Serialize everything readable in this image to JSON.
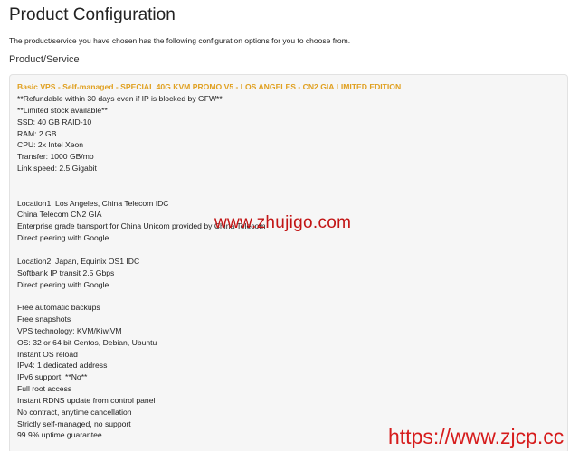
{
  "page": {
    "title": "Product Configuration",
    "intro": "The product/service you have chosen has the following configuration options for you to choose from.",
    "section_title": "Product/Service"
  },
  "product": {
    "name": "Basic VPS - Self-managed - SPECIAL 40G KVM PROMO V5 - LOS ANGELES - CN2 GIA LIMITED EDITION",
    "lines": [
      "**Refundable within 30 days even if IP is blocked by GFW**",
      "**Limited stock available**",
      "SSD: 40 GB RAID-10",
      "RAM: 2 GB",
      "CPU: 2x Intel Xeon",
      "Transfer: 1000 GB/mo",
      "Link speed: 2.5 Gigabit",
      "",
      "",
      "Location1: Los Angeles, China Telecom IDC",
      "China Telecom CN2 GIA",
      "Enterprise grade transport for China Unicom provided by China Telecom",
      "Direct peering with Google",
      "",
      "Location2: Japan, Equinix OS1 IDC",
      "Softbank IP transit 2.5 Gbps",
      "Direct peering with Google",
      "",
      "Free automatic backups",
      "Free snapshots",
      "VPS technology: KVM/KiwiVM",
      "OS: 32 or 64 bit Centos, Debian, Ubuntu",
      "Instant OS reload",
      "IPv4: 1 dedicated address",
      "IPv6 support: **No**",
      "Full root access",
      "Instant RDNS update from control panel",
      "No contract, anytime cancellation",
      "Strictly self-managed, no support",
      "99.9% uptime guarantee"
    ]
  },
  "watermarks": {
    "site1": "www.zhujigo.com",
    "site2": "https://www.zjcp.cc"
  },
  "colors": {
    "product_name": "#e0a020",
    "watermark": "#d61c1c",
    "panel_bg": "#f6f6f6"
  }
}
